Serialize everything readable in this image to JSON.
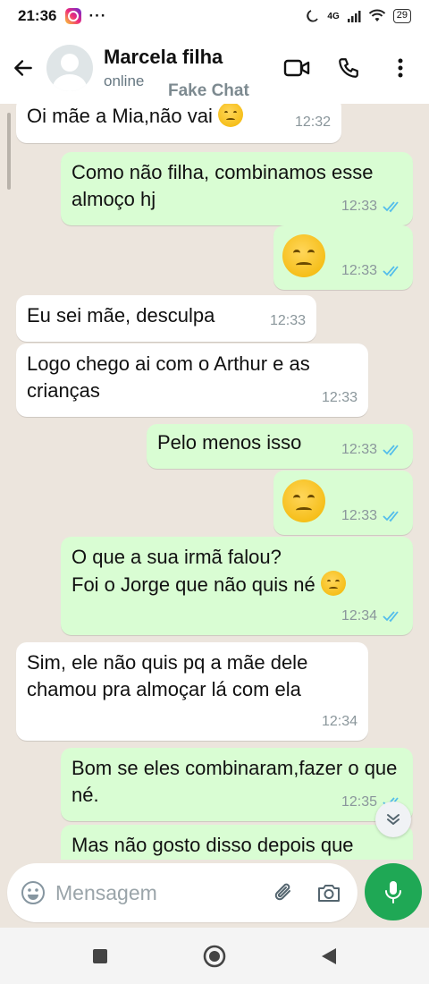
{
  "status_bar": {
    "time": "21:36",
    "overflow": "···",
    "network": "4G",
    "battery": "29"
  },
  "header": {
    "contact_name": "Marcela filha",
    "contact_status": "online",
    "watermark": "Fake Chat",
    "icons": [
      "back-arrow-icon",
      "avatar",
      "video-call-icon",
      "phone-icon",
      "more-vert-icon"
    ]
  },
  "messages": [
    {
      "dir": "in",
      "text": "Oi mãe a Mia,não vai",
      "emoji": "confused-emoji",
      "time": "12:32"
    },
    {
      "dir": "out",
      "text": "Como não filha, combinamos esse almoço hj",
      "time": "12:33",
      "ticks": "read"
    },
    {
      "dir": "out",
      "text": "",
      "emoji": "pensive-emoji",
      "time": "12:33",
      "ticks": "read"
    },
    {
      "dir": "in",
      "text": "Eu sei mãe, desculpa",
      "time": "12:33"
    },
    {
      "dir": "in",
      "text": "Logo chego ai com o Arthur e as crianças",
      "time": "12:33"
    },
    {
      "dir": "out",
      "text": "Pelo menos isso",
      "time": "12:33",
      "ticks": "read"
    },
    {
      "dir": "out",
      "text": "",
      "emoji": "pensive-emoji",
      "time": "12:33",
      "ticks": "read"
    },
    {
      "dir": "out",
      "text": "O que a sua irmã falou?",
      "text2": "Foi o Jorge que não quis né",
      "emoji": "confused-emoji",
      "time": "12:34",
      "ticks": "read"
    },
    {
      "dir": "in",
      "text": "Sim, ele não quis pq a mãe dele chamou pra almoçar lá com ela",
      "time": "12:34"
    },
    {
      "dir": "out",
      "text": "Bom se eles combinaram,fazer o que né.",
      "time": "12:35",
      "ticks": "read"
    },
    {
      "dir": "out",
      "text": "Mas não gosto disso depois que",
      "time": ""
    }
  ],
  "composer": {
    "placeholder": "Mensagem",
    "icons": [
      "emoji-icon",
      "attach-icon",
      "camera-icon",
      "mic-icon"
    ]
  },
  "colors": {
    "incoming_bubble": "#ffffff",
    "outgoing_bubble": "#d9fdd3",
    "chat_background": "#ece5dd",
    "read_ticks": "#53bdeb",
    "mic_button": "#1fa855"
  }
}
